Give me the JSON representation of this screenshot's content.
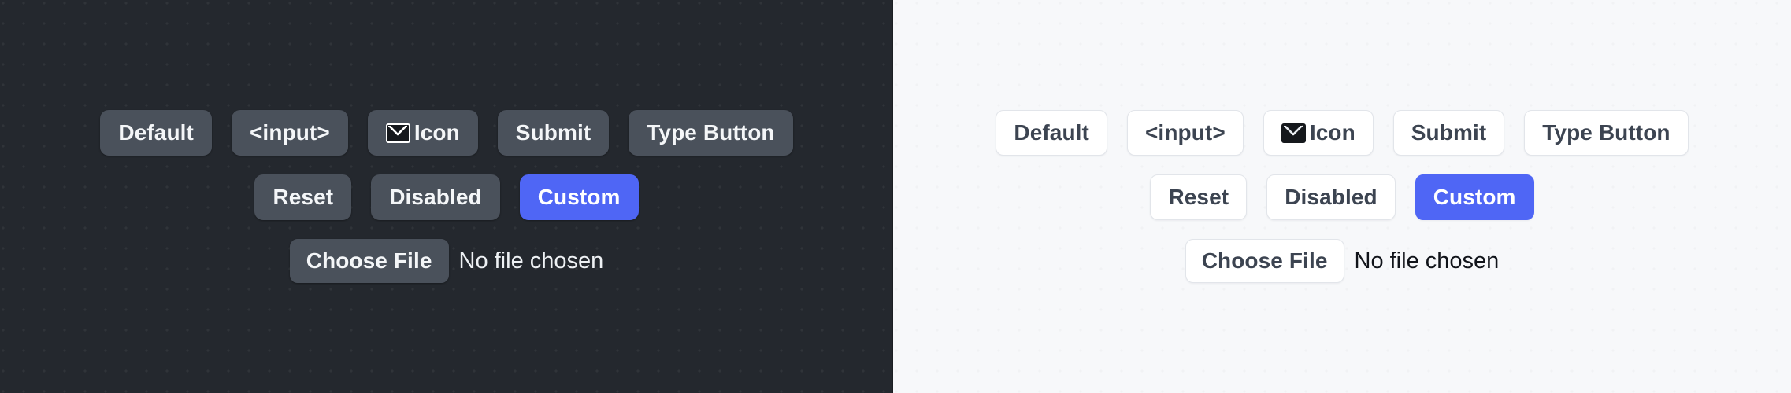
{
  "theme": {
    "dark_background": "#24282e",
    "light_background": "#f7f8fa",
    "dark_button_bg": "#4a515b",
    "dark_button_text": "#f4f6f8",
    "light_button_bg": "#ffffff",
    "light_button_border": "#e2e5ea",
    "light_button_text": "#3c4451",
    "accent": "#4f66f5",
    "accent_text": "#ffffff"
  },
  "panels": [
    {
      "name": "dark-theme-panel",
      "mode": "dark",
      "rows": [
        {
          "name": "button-row-primary",
          "buttons": [
            {
              "label": "Default",
              "icon": null,
              "variant": "default",
              "disabled": false
            },
            {
              "label": "<input>",
              "icon": null,
              "variant": "default",
              "disabled": false
            },
            {
              "label": "Icon",
              "icon": "envelope-icon",
              "variant": "default",
              "disabled": false
            },
            {
              "label": "Submit",
              "icon": null,
              "variant": "default",
              "disabled": false
            },
            {
              "label": "Type Button",
              "icon": null,
              "variant": "default",
              "disabled": false
            }
          ]
        },
        {
          "name": "button-row-secondary",
          "buttons": [
            {
              "label": "Reset",
              "icon": null,
              "variant": "default",
              "disabled": false
            },
            {
              "label": "Disabled",
              "icon": null,
              "variant": "default",
              "disabled": true
            },
            {
              "label": "Custom",
              "icon": null,
              "variant": "accent",
              "disabled": false
            }
          ]
        }
      ],
      "file_input": {
        "button_label": "Choose File",
        "status_text": "No file chosen"
      }
    },
    {
      "name": "light-theme-panel",
      "mode": "light",
      "rows": [
        {
          "name": "button-row-primary",
          "buttons": [
            {
              "label": "Default",
              "icon": null,
              "variant": "default",
              "disabled": false
            },
            {
              "label": "<input>",
              "icon": null,
              "variant": "default",
              "disabled": false
            },
            {
              "label": "Icon",
              "icon": "envelope-icon",
              "variant": "default",
              "disabled": false
            },
            {
              "label": "Submit",
              "icon": null,
              "variant": "default",
              "disabled": false
            },
            {
              "label": "Type Button",
              "icon": null,
              "variant": "default",
              "disabled": false
            }
          ]
        },
        {
          "name": "button-row-secondary",
          "buttons": [
            {
              "label": "Reset",
              "icon": null,
              "variant": "default",
              "disabled": false
            },
            {
              "label": "Disabled",
              "icon": null,
              "variant": "default",
              "disabled": true
            },
            {
              "label": "Custom",
              "icon": null,
              "variant": "accent",
              "disabled": false
            }
          ]
        }
      ],
      "file_input": {
        "button_label": "Choose File",
        "status_text": "No file chosen"
      }
    }
  ]
}
